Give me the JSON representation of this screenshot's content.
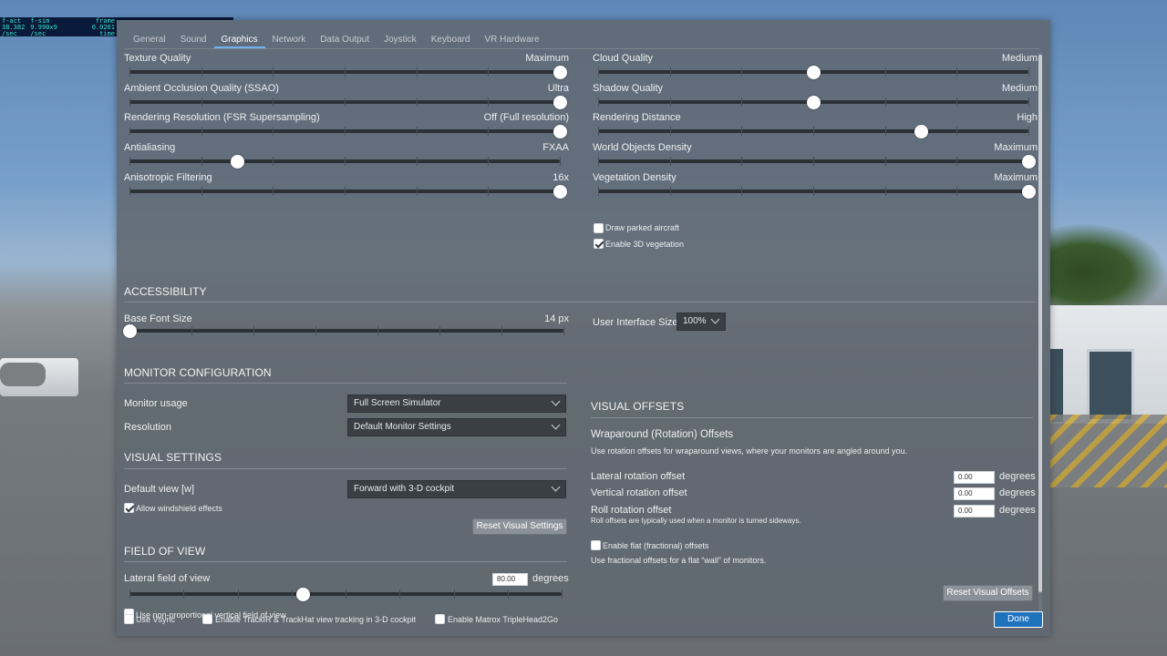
{
  "perf": {
    "col1": [
      "f-act",
      "38.382",
      "/sec"
    ],
    "col2": [
      "f-sim",
      "9.990x9",
      "/sec"
    ],
    "col3": [
      "frame",
      "0.0261",
      "time"
    ]
  },
  "tabs": [
    "General",
    "Sound",
    "Graphics",
    "Network",
    "Data Output",
    "Joystick",
    "Keyboard",
    "VR Hardware"
  ],
  "active_tab": "Graphics",
  "left_sliders": [
    {
      "label": "Texture Quality",
      "value": "Maximum",
      "level": 1.0
    },
    {
      "label": "Ambient Occlusion Quality (SSAO)",
      "value": "Ultra",
      "level": 1.0
    },
    {
      "label": "Rendering Resolution (FSR Supersampling)",
      "value": "Off (Full resolution)",
      "level": 1.0
    },
    {
      "label": "Antialiasing",
      "value": "FXAA",
      "level": 0.25
    },
    {
      "label": "Anisotropic Filtering",
      "value": "16x",
      "level": 1.0
    }
  ],
  "right_sliders": [
    {
      "label": "Cloud Quality",
      "value": "Medium",
      "level": 0.5
    },
    {
      "label": "Shadow Quality",
      "value": "Medium",
      "level": 0.5
    },
    {
      "label": "Rendering Distance",
      "value": "High",
      "level": 0.75
    },
    {
      "label": "World Objects Density",
      "value": "Maximum",
      "level": 1.0
    },
    {
      "label": "Vegetation Density",
      "value": "Maximum",
      "level": 1.0
    }
  ],
  "graphics_checks": [
    {
      "label": "Draw parked aircraft",
      "checked": false
    },
    {
      "label": "Enable 3D vegetation",
      "checked": true
    }
  ],
  "accessibility": {
    "title": "ACCESSIBILITY",
    "font_label": "Base Font Size",
    "font_value": "14 px",
    "font_level": 0.0,
    "ui_size_label": "User Interface Size",
    "ui_size_value": "100%"
  },
  "monitor": {
    "title": "MONITOR CONFIGURATION",
    "usage_label": "Monitor usage",
    "usage_value": "Full Screen Simulator",
    "resolution_label": "Resolution",
    "resolution_value": "Default Monitor Settings"
  },
  "visual_settings": {
    "title": "VISUAL SETTINGS",
    "default_view_label": "Default view [w]",
    "default_view_value": "Forward with 3-D cockpit",
    "windshield_label": "Allow windshield effects",
    "windshield_checked": true,
    "reset_label": "Reset Visual Settings"
  },
  "fov": {
    "title": "FIELD OF VIEW",
    "lateral_label": "Lateral field of view",
    "lateral_value": "80.00",
    "unit": "degrees",
    "level": 0.4,
    "nonprop_label": "Use non-proportional vertical field of view"
  },
  "visual_offsets": {
    "title": "VISUAL OFFSETS",
    "subtitle": "Wraparound (Rotation) Offsets",
    "desc": "Use rotation offsets for wraparound views, where your monitors are angled around you.",
    "rows": [
      {
        "label": "Lateral rotation offset",
        "value": "0.00",
        "unit": "degrees"
      },
      {
        "label": "Vertical rotation offset",
        "value": "0.00",
        "unit": "degrees"
      },
      {
        "label": "Roll rotation offset",
        "value": "0.00",
        "unit": "degrees"
      }
    ],
    "roll_note": "Roll offsets are typically used when a monitor is turned sideways.",
    "flat_label": "Enable flat (fractional) offsets",
    "flat_checked": false,
    "flat_desc": "Use fractional offsets for a flat “wall” of monitors.",
    "reset_label": "Reset Visual Offsets"
  },
  "footer": {
    "vsync": "Use Vsync",
    "trackir": "Enable TrackIR & TrackHat view tracking in 3-D cockpit",
    "matrox": "Enable Matrox TripleHead2Go",
    "done": "Done"
  },
  "colors": {
    "accent": "#1f73bd",
    "tab_underline": "#6fb3ee",
    "panel": "#606871"
  }
}
